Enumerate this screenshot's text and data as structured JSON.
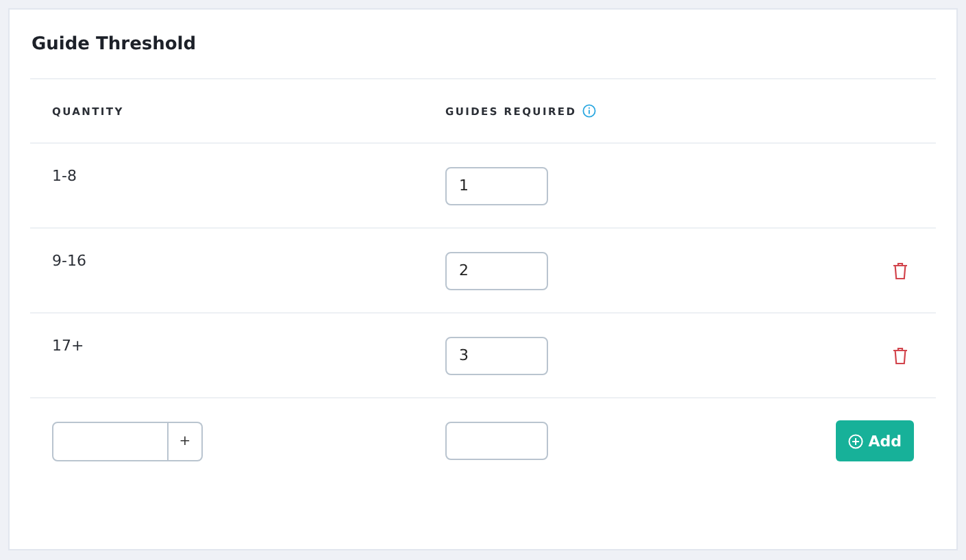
{
  "card": {
    "title": "Guide Threshold"
  },
  "table": {
    "columns": [
      {
        "label": "QUANTITY",
        "info": false
      },
      {
        "label": "GUIDES REQUIRED",
        "info": true
      }
    ],
    "rows": [
      {
        "quantity": "1-8",
        "guides": "1",
        "deletable": false
      },
      {
        "quantity": "9-16",
        "guides": "2",
        "deletable": true
      },
      {
        "quantity": "17+",
        "guides": "3",
        "deletable": true
      }
    ]
  },
  "new_row": {
    "stepper_label": "+",
    "add_label": "Add"
  }
}
